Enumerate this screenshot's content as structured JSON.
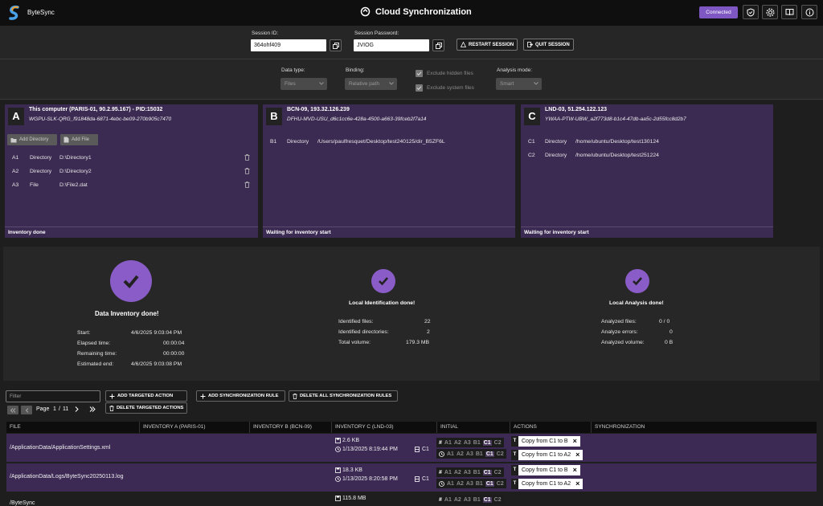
{
  "header": {
    "app_name": "ByteSync",
    "title": "Cloud Synchronization",
    "status": "Connected"
  },
  "session": {
    "id_label": "Session ID:",
    "id_value": "364ohf409",
    "password_label": "Session Password:",
    "password_value": "JVIOG",
    "restart_label": "RESTART SESSION",
    "quit_label": "QUIT SESSION"
  },
  "settings": {
    "data_type_label": "Data type:",
    "data_type_value": "Files",
    "binding_label": "Binding:",
    "binding_value": "Relative path",
    "exclude_hidden": "Exclude hidden files",
    "exclude_system": "Exclude system files",
    "analysis_label": "Analysis mode:",
    "analysis_value": "Smart"
  },
  "members": [
    {
      "letter": "A",
      "name": "This computer (PARIS-01, 90.2.95.167) - PID:15032",
      "id": "WGPU-SLK-QRG_f91848da-6871-4ebc-be09-270b905c7470",
      "add_directory": "Add Directory",
      "add_file": "Add File",
      "items": [
        {
          "code": "A1",
          "type": "Directory",
          "path": "D:\\Directory1"
        },
        {
          "code": "A2",
          "type": "Directory",
          "path": "D:\\Directory2"
        },
        {
          "code": "A3",
          "type": "File",
          "path": "D:\\File2.dat"
        }
      ],
      "status": "Inventory done"
    },
    {
      "letter": "B",
      "name": "BCN-09, 193.32.126.239",
      "id": "DFHU-MVD-USU_d6c1cc6e-428a-4500-a663-39fceb2f7a14",
      "items": [
        {
          "code": "B1",
          "type": "Directory",
          "path": "/Users/paulfresquet/Desktop/test240125/dir_B5ZF6L"
        }
      ],
      "status": "Waiting for inventory start"
    },
    {
      "letter": "C",
      "name": "LND-03, 51.254.122.123",
      "id": "YWAA-PTW-UBW_a2f773d8-b1c4-47db-aa5c-2d55fcc8d2b7",
      "items": [
        {
          "code": "C1",
          "type": "Directory",
          "path": "/home/ubuntu/Desktop/test130124"
        },
        {
          "code": "C2",
          "type": "Directory",
          "path": "/home/ubuntu/Desktop/test251224"
        }
      ],
      "status": "Waiting for inventory start"
    }
  ],
  "progress": {
    "inventory": {
      "title": "Data Inventory done!",
      "rows": [
        {
          "k": "Start:",
          "v": "4/6/2025 9:03:04 PM"
        },
        {
          "k": "Elapsed time:",
          "v": "00:00:04"
        },
        {
          "k": "Remaining time:",
          "v": "00:00:00"
        },
        {
          "k": "Estimated end:",
          "v": "4/6/2025 9:03:08 PM"
        }
      ]
    },
    "identification": {
      "title": "Local Identification done!",
      "rows": [
        {
          "k": "Identified files:",
          "v": "22"
        },
        {
          "k": "Identified directories:",
          "v": "2"
        },
        {
          "k": "Total volume:",
          "v": "179.3 MB"
        }
      ]
    },
    "analysis": {
      "title": "Local Analysis done!",
      "rows": [
        {
          "k": "Analyzed files:",
          "v": "0 / 0"
        },
        {
          "k": "Analyze errors:",
          "v": "0"
        },
        {
          "k": "Analyzed volume:",
          "v": "0 B"
        }
      ]
    }
  },
  "toolbar": {
    "filter_placeholder": "Filter",
    "add_targeted": "ADD TARGETED ACTION",
    "delete_targeted": "DELETE TARGETED ACTIONS",
    "add_rule": "ADD SYNCHRONIZATION RULE",
    "delete_rules": "DELETE ALL SYNCHRONIZATION RULES",
    "page_label": "Page",
    "page_current": "1",
    "page_sep": "/",
    "page_total": "11"
  },
  "table": {
    "columns": [
      "FILE",
      "INVENTORY A (PARIS-01)",
      "INVENTORY B (BCN-09)",
      "INVENTORY C (LND-03)",
      "INITIAL",
      "ACTIONS",
      "SYNCHRONIZATION"
    ],
    "rows": [
      {
        "file": "/ApplicationData/ApplicationSettings.xml",
        "size": "2.6 KB",
        "date": "1/13/2025 8:19:44 PM",
        "member": "C1",
        "actions": [
          "Copy from C1 to B",
          "Copy from C1 to A2"
        ]
      },
      {
        "file": "/ApplicationData/Logs/ByteSync20250113.log",
        "size": "18.3 KB",
        "date": "1/13/2025 8:20:58 PM",
        "member": "C1",
        "actions": [
          "Copy from C1 to B",
          "Copy from C1 to A2"
        ]
      },
      {
        "file": "/ByteSync",
        "size": "115.8 MB",
        "date": "",
        "member": "",
        "actions": []
      }
    ],
    "initial_codes": [
      "A1",
      "A2",
      "A3",
      "B1",
      "C1",
      "C2"
    ],
    "hash_symbol": "#",
    "action_prefix": "T",
    "remove_symbol": "×"
  }
}
